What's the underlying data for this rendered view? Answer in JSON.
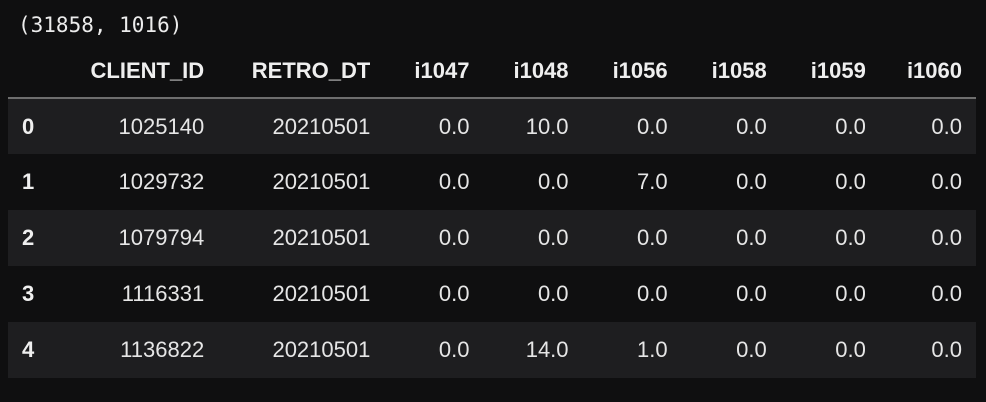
{
  "output": {
    "shape": "(31858, 1016)"
  },
  "table": {
    "index_header": "",
    "columns": [
      "CLIENT_ID",
      "RETRO_DT",
      "i1047",
      "i1048",
      "i1056",
      "i1058",
      "i1059",
      "i1060"
    ],
    "rows": [
      {
        "index": "0",
        "cells": [
          "1025140",
          "20210501",
          "0.0",
          "10.0",
          "0.0",
          "0.0",
          "0.0",
          "0.0"
        ]
      },
      {
        "index": "1",
        "cells": [
          "1029732",
          "20210501",
          "0.0",
          "0.0",
          "7.0",
          "0.0",
          "0.0",
          "0.0"
        ]
      },
      {
        "index": "2",
        "cells": [
          "1079794",
          "20210501",
          "0.0",
          "0.0",
          "0.0",
          "0.0",
          "0.0",
          "0.0"
        ]
      },
      {
        "index": "3",
        "cells": [
          "1116331",
          "20210501",
          "0.0",
          "0.0",
          "0.0",
          "0.0",
          "0.0",
          "0.0"
        ]
      },
      {
        "index": "4",
        "cells": [
          "1136822",
          "20210501",
          "0.0",
          "14.0",
          "1.0",
          "0.0",
          "0.0",
          "0.0"
        ]
      }
    ]
  },
  "colors": {
    "background": "#0f0f10",
    "row_stripe": "#1e1e20",
    "text": "#e6e6e6",
    "header_rule": "#6e6e6e"
  }
}
